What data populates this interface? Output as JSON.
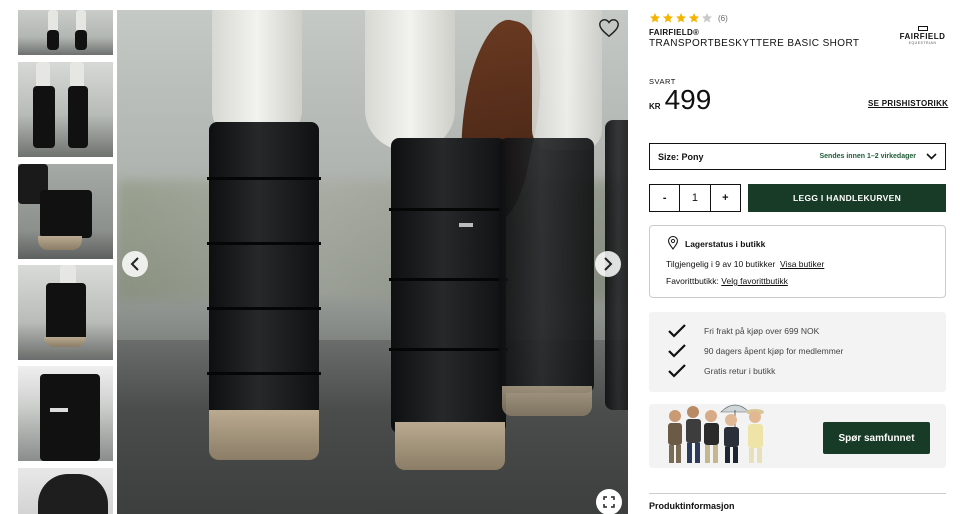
{
  "gallery": {
    "thumbnail_count": 6,
    "prev_icon": "chevron-left-icon",
    "next_icon": "chevron-right-icon",
    "favorite_icon": "heart-icon",
    "fullscreen_icon": "expand-icon"
  },
  "product": {
    "rating_stars": 4,
    "rating_max": 5,
    "review_count": "(6)",
    "brand": "FAIRFIELD®",
    "name": "TRANSPORTBESKYTTERE BASIC SHORT",
    "logo_text": "FAIRFIELD",
    "logo_subtext": "EQUESTRIAN",
    "color_label": "SVART",
    "currency": "KR",
    "price": "499",
    "price_history_link": "SE PRISHISTORIKK"
  },
  "purchase": {
    "size_label": "Size: Pony",
    "shipping_note": "Sendes innen 1–2 virkedager",
    "qty_minus": "-",
    "qty_value": "1",
    "qty_plus": "+",
    "add_to_cart": "LEGG I HANDLEKURVEN"
  },
  "stock": {
    "title": "Lagerstatus i butikk",
    "availability": "Tilgjengelig i 9 av 10 butikker",
    "show_stores_link": "Visa butiker",
    "favorite_store_label": "Favorittbutikk:",
    "choose_favorite_link": "Velg favorittbutikk"
  },
  "usps": [
    "Fri frakt på kjøp over 699 NOK",
    "90 dagers åpent kjøp for medlemmer",
    "Gratis retur i butikk"
  ],
  "community": {
    "button": "Spør samfunnet"
  },
  "info": {
    "heading": "Produktinformasjon"
  },
  "colors": {
    "primary_green": "#173b26",
    "star_gold": "#f4b400",
    "ship_green": "#1d5b36"
  }
}
